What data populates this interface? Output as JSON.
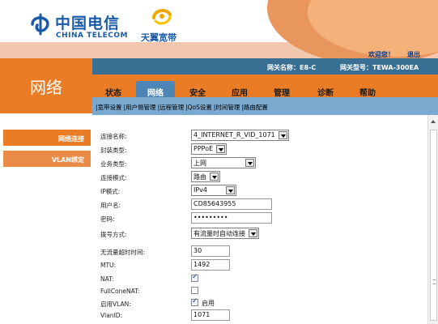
{
  "header": {
    "brand_cn": "中国电信",
    "brand_en": "CHINA TELECOM",
    "tianyi": "天翼宽带",
    "welcome": "欢迎您！",
    "logout": "退出",
    "gateway_name": "网关名称：E8-C",
    "gateway_model": "网关型号：TEWA-300EA",
    "section_title": "网络"
  },
  "nav": {
    "tabs": [
      "状态",
      "网络",
      "安全",
      "应用",
      "管理",
      "诊断",
      "帮助"
    ],
    "active_index": 1
  },
  "subnav": [
    "|宽带设置",
    "|用户侧管理",
    "|远程管理",
    "|QoS设置",
    "|时间管理",
    "|路由配置"
  ],
  "leftmenu": [
    "网络连接",
    "VLAN绑定"
  ],
  "form": {
    "conn_name_label": "连接名称:",
    "conn_name_value": "4_INTERNET_R_VID_1071",
    "encap_label": "封装类型:",
    "encap_value": "PPPoE",
    "service_label": "业务类型:",
    "service_value": "上网",
    "mode_label": "连接模式:",
    "mode_value": "路由",
    "ip_label": "IP模式:",
    "ip_value": "IPv4",
    "user_label": "用户名:",
    "user_value": "CD85643955",
    "pwd_label": "密码:",
    "pwd_value": "•••••••••",
    "dial_label": "拨号方式:",
    "dial_value": "有流量时自动连接",
    "idle_label": "无流量超时时间:",
    "idle_value": "30",
    "mtu_label": "MTU:",
    "mtu_value": "1492",
    "nat_label": "NAT:",
    "nat_checked": true,
    "fullcone_label": "FullConeNAT:",
    "fullcone_checked": false,
    "vlan_label": "启用VLAN:",
    "vlan_checked": true,
    "vlan_text": "启用",
    "vlanid_label": "VlanID:",
    "vlanid_value": "1071"
  }
}
